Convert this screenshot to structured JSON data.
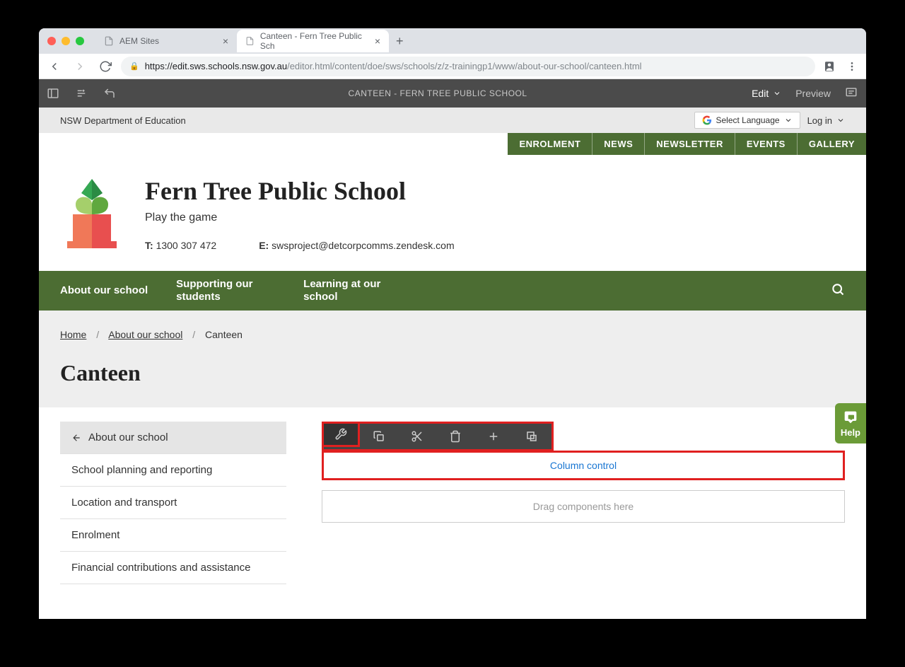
{
  "browser": {
    "tabs": [
      {
        "title": "AEM Sites",
        "active": false
      },
      {
        "title": "Canteen - Fern Tree Public Sch",
        "active": true
      }
    ],
    "url_domain": "https://edit.sws.schools.nsw.gov.au",
    "url_path": "/editor.html/content/doe/sws/schools/z/z-trainingp1/www/about-our-school/canteen.html"
  },
  "aem": {
    "title": "CANTEEN - FERN TREE PUBLIC SCHOOL",
    "mode": "Edit",
    "preview": "Preview"
  },
  "gov_bar": {
    "dept": "NSW Department of Education",
    "lang": "Select Language",
    "login": "Log in"
  },
  "quick_nav": [
    "ENROLMENT",
    "NEWS",
    "NEWSLETTER",
    "EVENTS",
    "GALLERY"
  ],
  "school": {
    "name": "Fern Tree Public School",
    "tagline": "Play the game",
    "phone_label": "T:",
    "phone": "1300 307 472",
    "email_label": "E:",
    "email": "swsproject@detcorpcomms.zendesk.com"
  },
  "main_nav": [
    "About our school",
    "Supporting our students",
    "Learning at our school"
  ],
  "breadcrumb": {
    "home": "Home",
    "parent": "About our school",
    "current": "Canteen"
  },
  "page_title": "Canteen",
  "sidenav": [
    {
      "label": "About our school",
      "active": true
    },
    {
      "label": "School planning and reporting",
      "active": false
    },
    {
      "label": "Location and transport",
      "active": false
    },
    {
      "label": "Enrolment",
      "active": false
    },
    {
      "label": "Financial contributions and assistance",
      "active": false
    }
  ],
  "editor": {
    "column_control": "Column control",
    "drop_hint": "Drag components here"
  },
  "help": "Help"
}
